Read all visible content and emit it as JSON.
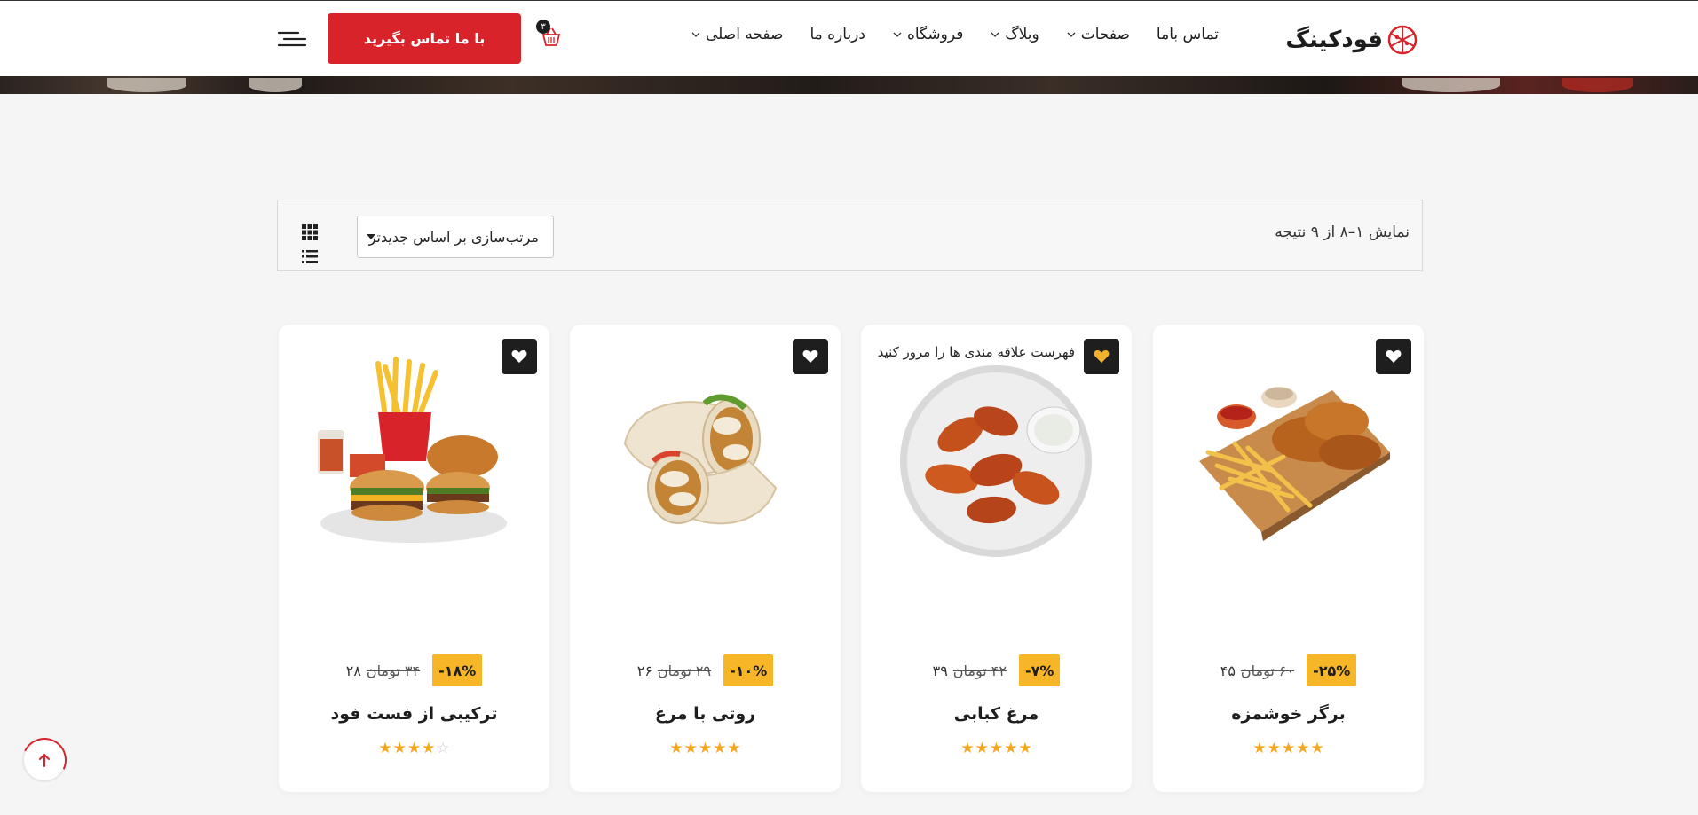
{
  "header": {
    "logo_text": "فودکینگ",
    "nav": [
      {
        "label": "صفحه اصلی",
        "dropdown": true
      },
      {
        "label": "درباره ما",
        "dropdown": false
      },
      {
        "label": "فروشگاه",
        "dropdown": true
      },
      {
        "label": "وبلاگ",
        "dropdown": true
      },
      {
        "label": "صفحات",
        "dropdown": true
      },
      {
        "label": "تماس باما",
        "dropdown": false
      }
    ],
    "cart_count": "۳",
    "contact_button": "با ما تماس بگیرید"
  },
  "toolbar": {
    "result_count": "نمایش ۱–۸ از ۹ نتیجه",
    "sort_selected": "مرتب‌سازی بر اساس جدیدتر"
  },
  "products": [
    {
      "name": "برگر خوشمزه",
      "discount": "-۲۵%",
      "old_price": "۶۰ تومان",
      "price": "۴۵",
      "rating": 5,
      "wishlisted": false,
      "tooltip": ""
    },
    {
      "name": "مرغ کبابی",
      "discount": "-۷%",
      "old_price": "۴۲ تومان",
      "price": "۳۹",
      "rating": 5,
      "wishlisted": true,
      "tooltip": "فهرست علاقه مندی ها را مرور کنید"
    },
    {
      "name": "روتی با مرغ",
      "discount": "-۱۰%",
      "old_price": "۲۹ تومان",
      "price": "۲۶",
      "rating": 5,
      "wishlisted": false,
      "tooltip": ""
    },
    {
      "name": "ترکیبی از فست فود",
      "discount": "-۱۸%",
      "old_price": "۳۴ تومان",
      "price": "۲۸",
      "rating": 4,
      "wishlisted": false,
      "tooltip": ""
    }
  ],
  "colors": {
    "brand_red": "#d8232a",
    "accent_yellow": "#f7b628",
    "dark": "#1e1e1e"
  }
}
